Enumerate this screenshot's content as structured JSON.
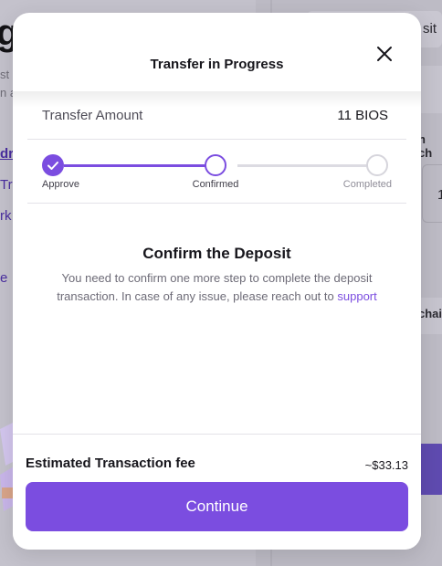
{
  "background": {
    "big_title_fragment": "g",
    "muted_line_1": "st",
    "muted_line_2": "n a",
    "link_1": "dr",
    "link_2": "Tr",
    "link_3": "rk",
    "link_4": "e",
    "deposit_tab": "sit",
    "edge_text_1": "n ch",
    "edge_value": "1",
    "edge_text_2": "chai"
  },
  "modal": {
    "title": "Transfer in Progress",
    "close_icon": "close-icon",
    "transfer_amount_label": "Transfer Amount",
    "transfer_amount_value": "11 BIOS",
    "steps": [
      {
        "label": "Approve",
        "state": "done"
      },
      {
        "label": "Confirmed",
        "state": "current"
      },
      {
        "label": "Completed",
        "state": "pending"
      }
    ],
    "confirm_title": "Confirm the Deposit",
    "confirm_desc": "You need to confirm one more step to complete the deposit transaction. In case of any issue, please reach out to",
    "support_link": "support",
    "fee_label": "Estimated Transaction fee",
    "fee_value": "~$33.13",
    "continue_label": "Continue"
  },
  "colors": {
    "accent": "#7b4de0",
    "text": "#17161c",
    "muted": "#6d6b77",
    "divider": "#e3e2e8"
  }
}
